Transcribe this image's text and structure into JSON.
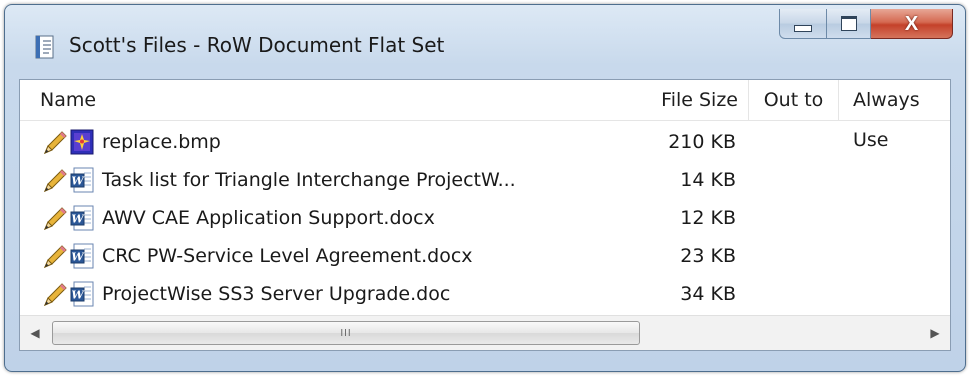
{
  "window": {
    "title": "Scott's Files - RoW Document Flat Set",
    "title_icon": "document-icon",
    "caption_buttons": {
      "minimize_icon": "minimize-icon",
      "maximize_icon": "maximize-icon",
      "close_label": "X"
    }
  },
  "columns": {
    "name": "Name",
    "file_size": "File Size",
    "out_to": "Out to",
    "always_use": "Always Use"
  },
  "files": [
    {
      "name": "replace.bmp",
      "size": "210 KB",
      "icon": "bitmap-icon"
    },
    {
      "name": "Task list for Triangle Interchange ProjectW...",
      "size": "14 KB",
      "icon": "word-doc-icon"
    },
    {
      "name": "AWV CAE Application Support.docx",
      "size": "12 KB",
      "icon": "word-doc-icon"
    },
    {
      "name": "CRC PW-Service Level Agreement.docx",
      "size": "23 KB",
      "icon": "word-doc-icon"
    },
    {
      "name": "ProjectWise SS3 Server Upgrade.doc",
      "size": "34 KB",
      "icon": "word-doc-icon"
    }
  ],
  "scrollbar": {
    "left_arrow": "◀",
    "right_arrow": "▶",
    "grip": "III"
  },
  "colors": {
    "title_bar": "#c8d9ec",
    "close_button": "#c4412a",
    "word_icon": "#2b5797"
  }
}
